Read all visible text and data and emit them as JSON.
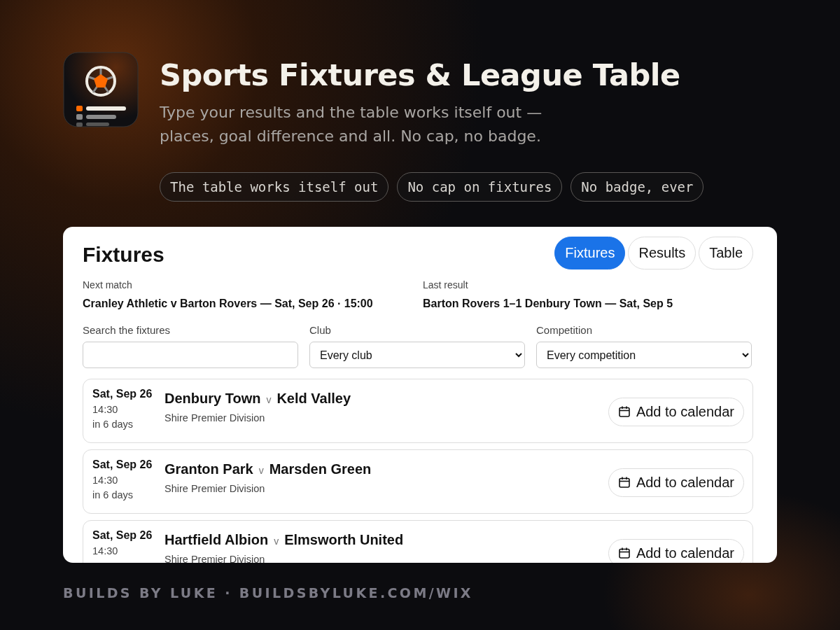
{
  "header": {
    "title": "Sports Fixtures & League Table",
    "subtitle_lines": [
      "Type your results and the table works itself out —",
      "places, goal difference and all. No cap, no badge."
    ],
    "chips": [
      "The table works itself out",
      "No cap on fixtures",
      "No badge, ever"
    ]
  },
  "panel": {
    "title": "Fixtures",
    "tabs": [
      {
        "label": "Fixtures",
        "selected": true
      },
      {
        "label": "Results",
        "selected": false
      },
      {
        "label": "Table",
        "selected": false
      }
    ],
    "summary": [
      {
        "label": "Next match",
        "value": "Cranley Athletic v Barton Rovers — Sat, Sep 26 · 15:00"
      },
      {
        "label": "Last result",
        "value": "Barton Rovers 1–1 Denbury Town — Sat, Sep 5"
      }
    ],
    "filters": [
      {
        "kind": "search",
        "label": "Search the fixtures"
      },
      {
        "kind": "select",
        "label": "Club",
        "value": "Every club"
      },
      {
        "kind": "select",
        "label": "Competition",
        "value": "Every competition"
      }
    ],
    "fixtures": [
      {
        "date": "Sat, Sep 26",
        "time": "14:30",
        "countdown": "in 6 days",
        "home": "Denbury Town",
        "separator": "v",
        "away": "Keld Valley",
        "competition": "Shire Premier Division",
        "button": "Add to calendar"
      },
      {
        "date": "Sat, Sep 26",
        "time": "14:30",
        "countdown": "in 6 days",
        "home": "Granton Park",
        "separator": "v",
        "away": "Marsden Green",
        "competition": "Shire Premier Division",
        "button": "Add to calendar"
      },
      {
        "date": "Sat, Sep 26",
        "time": "14:30",
        "home": "Hartfield Albion",
        "separator": "v",
        "away": "Elmsworth United",
        "competition": "Shire Premier Division",
        "button": "Add to calendar"
      }
    ]
  },
  "footer": "BUILDS BY LUKE · BUILDSBYLUKE.COM/WIX"
}
